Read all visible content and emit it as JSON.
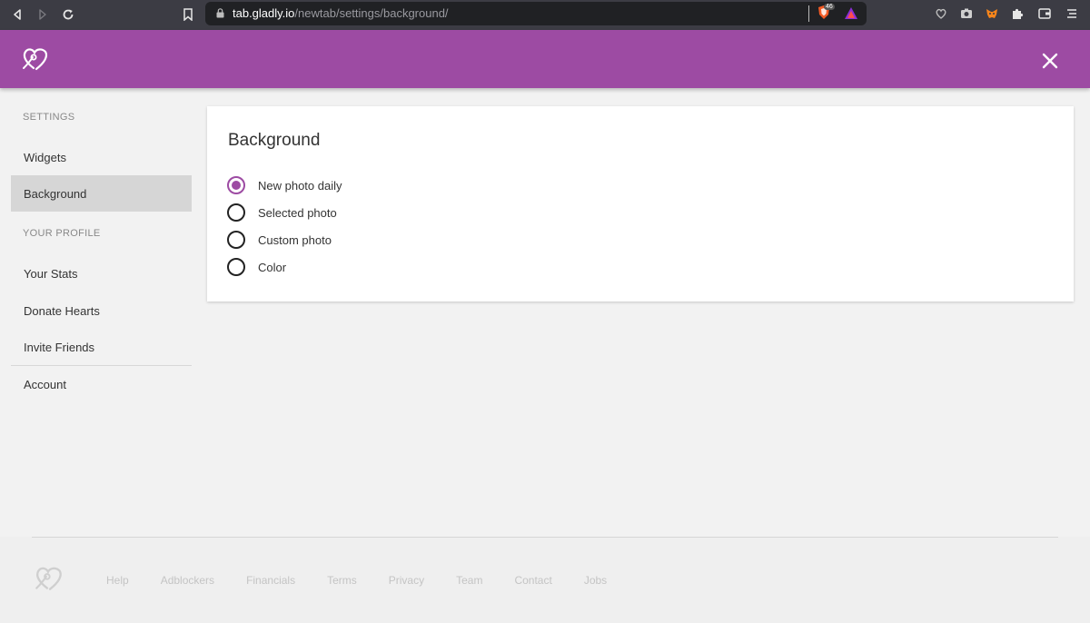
{
  "browser": {
    "url_host": "tab.gladly.io",
    "url_path": "/newtab/settings/background/",
    "brave_badge": "46"
  },
  "header": {
    "logo_icon": "heart-logo-icon",
    "close_icon": "close-icon",
    "bg_color": "#9d4ba3"
  },
  "sidebar": {
    "settings_label": "SETTINGS",
    "settings_items": [
      {
        "label": "Widgets"
      },
      {
        "label": "Background"
      }
    ],
    "profile_label": "YOUR PROFILE",
    "profile_items": [
      {
        "label": "Your Stats"
      },
      {
        "label": "Donate Hearts"
      },
      {
        "label": "Invite Friends"
      }
    ],
    "account_label": "Account"
  },
  "background_card": {
    "title": "Background",
    "options": [
      {
        "label": "New photo daily",
        "selected": true
      },
      {
        "label": "Selected photo",
        "selected": false
      },
      {
        "label": "Custom photo",
        "selected": false
      },
      {
        "label": "Color",
        "selected": false
      }
    ]
  },
  "footer": {
    "links": [
      "Help",
      "Adblockers",
      "Financials",
      "Terms",
      "Privacy",
      "Team",
      "Contact",
      "Jobs"
    ]
  }
}
